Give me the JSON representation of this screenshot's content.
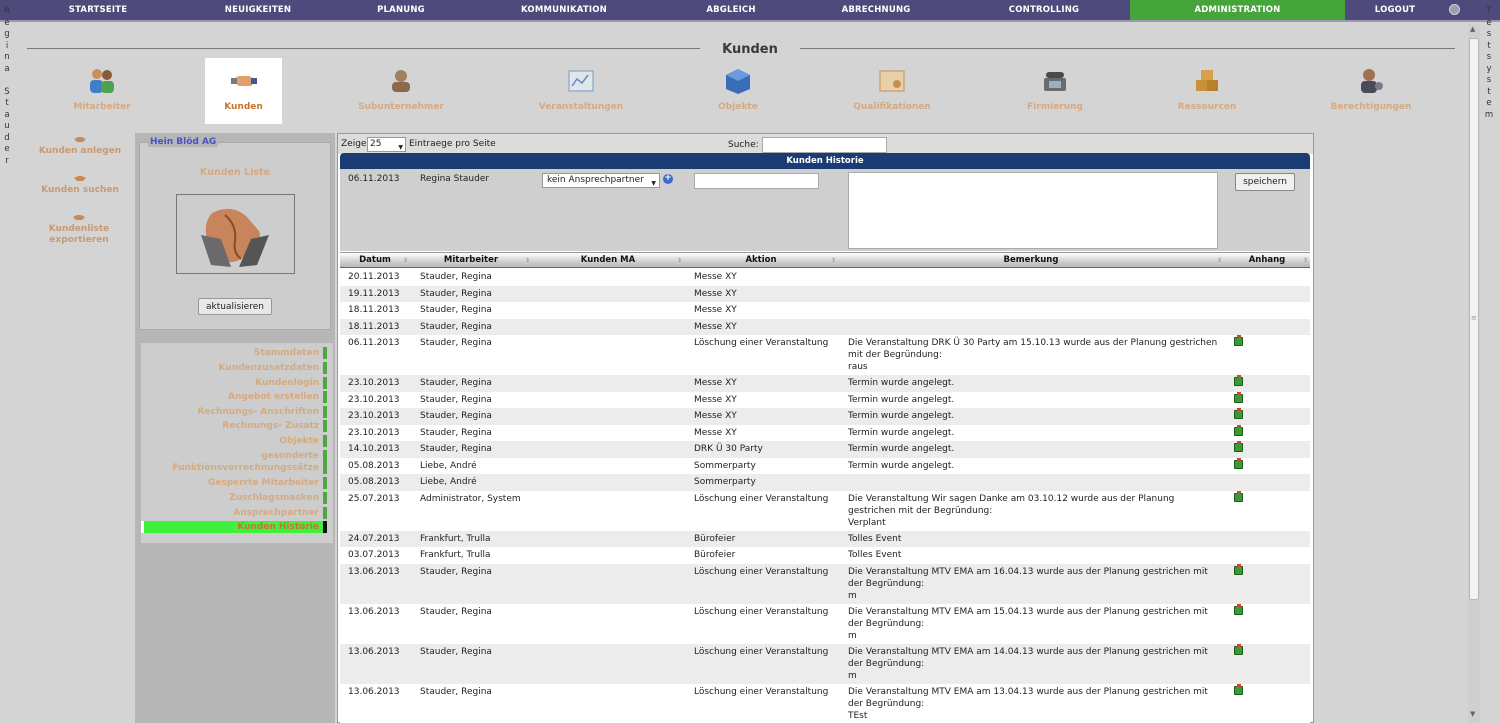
{
  "nav": {
    "items": [
      "STARTSEITE",
      "NEUIGKEITEN",
      "PLANUNG",
      "KOMMUNIKATION",
      "ABGLEICH",
      "ABRECHNUNG",
      "CONTROLLING",
      "ADMINISTRATION",
      "LOGOUT"
    ],
    "active": "ADMINISTRATION"
  },
  "side_labels": {
    "user": "Regina Stauder",
    "system": "Testsystem"
  },
  "page_title": "Kunden",
  "modules": [
    {
      "label": "Mitarbeiter",
      "icon": "employees-icon"
    },
    {
      "label": "Kunden",
      "icon": "handshake-icon",
      "active": true
    },
    {
      "label": "Subunternehmer",
      "icon": "subcontractor-icon"
    },
    {
      "label": "Veranstaltungen",
      "icon": "events-icon"
    },
    {
      "label": "Objekte",
      "icon": "cube-icon"
    },
    {
      "label": "Qualifikationen",
      "icon": "certificate-icon"
    },
    {
      "label": "Firmierung",
      "icon": "phone-icon"
    },
    {
      "label": "Ressourcen",
      "icon": "boxes-icon"
    },
    {
      "label": "Berechtigungen",
      "icon": "permissions-icon"
    }
  ],
  "left_actions": [
    "Kunden anlegen",
    "Kunden suchen",
    "Kundenliste exportieren"
  ],
  "customer": {
    "name": "Hein Blöd AG",
    "list_label": "Kunden Liste",
    "refresh_label": "aktualisieren"
  },
  "submenu": [
    "Stammdaten",
    "Kundenzusatzdaten",
    "Kundenlogin",
    "Angebot erstellen",
    "Rechnungs- Anschriften",
    "Rechnungs- Zusatz",
    "Objekte",
    "gesonderte Funktionsverrechnungssätze",
    "Gesperrte Mitarbeiter",
    "Zuschlagsmasken",
    "Ansprechpartner",
    "Kunden Historie"
  ],
  "submenu_active": "Kunden Historie",
  "toolbar": {
    "show_label": "Zeige",
    "entries_value": "25",
    "entries_label": "Eintraege pro Seite",
    "search_label": "Suche:"
  },
  "history": {
    "header": "Kunden Historie",
    "new_entry": {
      "date": "06.11.2013",
      "employee": "Regina Stauder",
      "contact": "kein Ansprechpartner",
      "save_label": "speichern"
    },
    "columns": [
      "Datum",
      "Mitarbeiter",
      "Kunden MA",
      "Aktion",
      "Bemerkung",
      "Anhang"
    ],
    "rows": [
      {
        "date": "20.11.2013",
        "emp": "Stauder, Regina",
        "act": "Messe XY",
        "rem": "",
        "att": false
      },
      {
        "date": "19.11.2013",
        "emp": "Stauder, Regina",
        "act": "Messe XY",
        "rem": "",
        "att": false
      },
      {
        "date": "18.11.2013",
        "emp": "Stauder, Regina",
        "act": "Messe XY",
        "rem": "",
        "att": false
      },
      {
        "date": "18.11.2013",
        "emp": "Stauder, Regina",
        "act": "Messe XY",
        "rem": "",
        "att": false
      },
      {
        "date": "06.11.2013",
        "emp": "Stauder, Regina",
        "act": "Löschung einer Veranstaltung",
        "rem": "Die Veranstaltung DRK Ü 30 Party am 15.10.13 wurde aus der Planung gestrichen\nmit der Begründung:\nraus",
        "att": true
      },
      {
        "date": "23.10.2013",
        "emp": "Stauder, Regina",
        "act": "Messe XY",
        "rem": "Termin wurde angelegt.",
        "att": true
      },
      {
        "date": "23.10.2013",
        "emp": "Stauder, Regina",
        "act": "Messe XY",
        "rem": "Termin wurde angelegt.",
        "att": true
      },
      {
        "date": "23.10.2013",
        "emp": "Stauder, Regina",
        "act": "Messe XY",
        "rem": "Termin wurde angelegt.",
        "att": true
      },
      {
        "date": "23.10.2013",
        "emp": "Stauder, Regina",
        "act": "Messe XY",
        "rem": "Termin wurde angelegt.",
        "att": true
      },
      {
        "date": "14.10.2013",
        "emp": "Stauder, Regina",
        "act": "DRK Ü 30 Party",
        "rem": "Termin wurde angelegt.",
        "att": true
      },
      {
        "date": "05.08.2013",
        "emp": "Liebe, André",
        "act": "Sommerparty",
        "rem": "Termin wurde angelegt.",
        "att": true
      },
      {
        "date": "05.08.2013",
        "emp": "Liebe, André",
        "act": "Sommerparty",
        "rem": "",
        "att": false
      },
      {
        "date": "25.07.2013",
        "emp": "Administrator, System",
        "act": "Löschung einer Veranstaltung",
        "rem": "Die Veranstaltung Wir sagen Danke am 03.10.12 wurde aus der Planung\ngestrichen mit der Begründung:\nVerplant",
        "att": true
      },
      {
        "date": "24.07.2013",
        "emp": "Frankfurt, Trulla",
        "act": "Bürofeier",
        "rem": "Tolles Event",
        "att": false
      },
      {
        "date": "03.07.2013",
        "emp": "Frankfurt, Trulla",
        "act": "Bürofeier",
        "rem": "Tolles Event",
        "att": false
      },
      {
        "date": "13.06.2013",
        "emp": "Stauder, Regina",
        "act": "Löschung einer Veranstaltung",
        "rem": "Die Veranstaltung MTV EMA am 16.04.13 wurde aus der Planung gestrichen mit\nder Begründung:\nm",
        "att": true
      },
      {
        "date": "13.06.2013",
        "emp": "Stauder, Regina",
        "act": "Löschung einer Veranstaltung",
        "rem": "Die Veranstaltung MTV EMA am 15.04.13 wurde aus der Planung gestrichen mit\nder Begründung:\nm",
        "att": true
      },
      {
        "date": "13.06.2013",
        "emp": "Stauder, Regina",
        "act": "Löschung einer Veranstaltung",
        "rem": "Die Veranstaltung MTV EMA am 14.04.13 wurde aus der Planung gestrichen mit\nder Begründung:\nm",
        "att": true
      },
      {
        "date": "13.06.2013",
        "emp": "Stauder, Regina",
        "act": "Löschung einer Veranstaltung",
        "rem": "Die Veranstaltung MTV EMA am 13.04.13 wurde aus der Planung gestrichen mit\nder Begründung:\nTEst",
        "att": true
      }
    ]
  }
}
